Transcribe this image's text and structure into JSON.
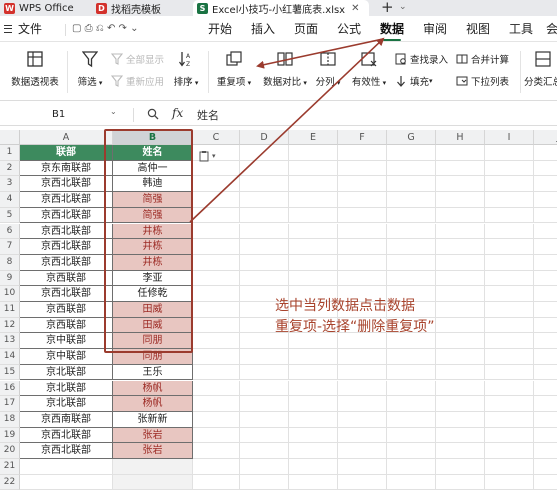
{
  "window_tabs": [
    {
      "label": "WPS Office",
      "icon": "wps-logo-icon",
      "color": "#d3312c"
    },
    {
      "label": "找稻壳模板",
      "icon": "docer-icon",
      "color": "#d3312c"
    },
    {
      "label": "Excel小技巧-小红薯底表.xlsx",
      "icon": "excel-file-icon",
      "color": "#1a7343"
    }
  ],
  "new_tab_label": "+",
  "menu": {
    "file_label": "文件",
    "tabs": [
      "开始",
      "插入",
      "页面",
      "公式",
      "数据",
      "审阅",
      "视图",
      "工具"
    ],
    "active_tab": "数据",
    "more_label": "会"
  },
  "ribbon": {
    "pivot_table": "数据透视表",
    "filter": "筛选",
    "show_all": "全部显示",
    "reapply": "重新应用",
    "sort": "排序",
    "duplicates": "重复项",
    "compare": "数据对比",
    "split": "分列",
    "validity": "有效性",
    "lookup_entry": "查找录入",
    "fill": "填充",
    "merge_calc": "合并计算",
    "dropdown_list": "下拉列表",
    "subtotal": "分类汇总"
  },
  "formula_bar": {
    "name_box": "B1",
    "fx_label": "fx",
    "zoom_icon": "zoom-icon",
    "value": "姓名"
  },
  "columns": [
    "A",
    "B",
    "C",
    "D",
    "E",
    "F",
    "G",
    "H",
    "I",
    "J"
  ],
  "selected_column": "B",
  "table": {
    "headers": [
      "联部",
      "姓名"
    ],
    "rows": [
      {
        "dept": "京东南联部",
        "name": "高仲一",
        "dup": false
      },
      {
        "dept": "京西北联部",
        "name": "韩迪",
        "dup": false
      },
      {
        "dept": "京西北联部",
        "name": "简强",
        "dup": true
      },
      {
        "dept": "京西北联部",
        "name": "简强",
        "dup": true
      },
      {
        "dept": "京西北联部",
        "name": "井栋",
        "dup": true
      },
      {
        "dept": "京西北联部",
        "name": "井栋",
        "dup": true
      },
      {
        "dept": "京西北联部",
        "name": "井栋",
        "dup": true
      },
      {
        "dept": "京西联部",
        "name": "李亚",
        "dup": false
      },
      {
        "dept": "京西北联部",
        "name": "任修乾",
        "dup": false
      },
      {
        "dept": "京西联部",
        "name": "田威",
        "dup": true
      },
      {
        "dept": "京西联部",
        "name": "田威",
        "dup": true
      },
      {
        "dept": "京中联部",
        "name": "同朋",
        "dup": true
      },
      {
        "dept": "京中联部",
        "name": "同朋",
        "dup": true
      },
      {
        "dept": "京北联部",
        "name": "王乐",
        "dup": false
      },
      {
        "dept": "京北联部",
        "name": "杨帆",
        "dup": true
      },
      {
        "dept": "京北联部",
        "name": "杨帆",
        "dup": true
      },
      {
        "dept": "京西南联部",
        "name": "张新新",
        "dup": false
      },
      {
        "dept": "京西北联部",
        "name": "张岩",
        "dup": true
      },
      {
        "dept": "京西北联部",
        "name": "张岩",
        "dup": true
      }
    ]
  },
  "annotation": {
    "line1": "选中当列数据点击数据",
    "line2": "重复项-选择“删除重复项”"
  },
  "colors": {
    "accent_green": "#1a7343",
    "header_green": "#3d8a5e",
    "duplicate_fill": "#e8c6c1",
    "duplicate_text": "#9c2a24",
    "annotation_red": "#a8432c"
  }
}
